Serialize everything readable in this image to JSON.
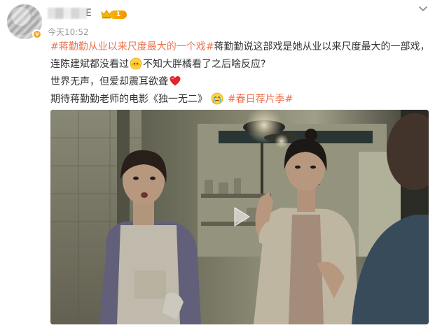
{
  "user": {
    "name_visible_tail": "E",
    "vip_level": "1",
    "timestamp": "今天10:52"
  },
  "post": {
    "line1_tag": "#蒋勤勤从业以来尺度最大的一个戏#",
    "line1_text": "蒋勤勤说这部戏是她从业以来尺度最大的一部戏，",
    "line2_text_a": "连陈建斌都没看过",
    "line2_text_b": "不知大胖橘看了之后啥反应?",
    "line3_text": "世界无声，但爱却震耳欲聋",
    "line4_text": "期待蒋勤勤老师的电影《独一无二》",
    "line4_tag": "#春日荐片季#"
  },
  "icons": {
    "menu": "chevron-down-icon",
    "verified": "verified-badge-icon",
    "vip": "crown-icon",
    "emoji_peek": "peeking-emoji-icon",
    "emoji_heart": "red-heart-icon",
    "emoji_cry": "crying-emoji-icon",
    "play": "play-icon"
  },
  "colors": {
    "tag": "#eb7350",
    "timestamp": "#999999",
    "vip_gold": "#f7b500",
    "heart": "#e0262c"
  }
}
